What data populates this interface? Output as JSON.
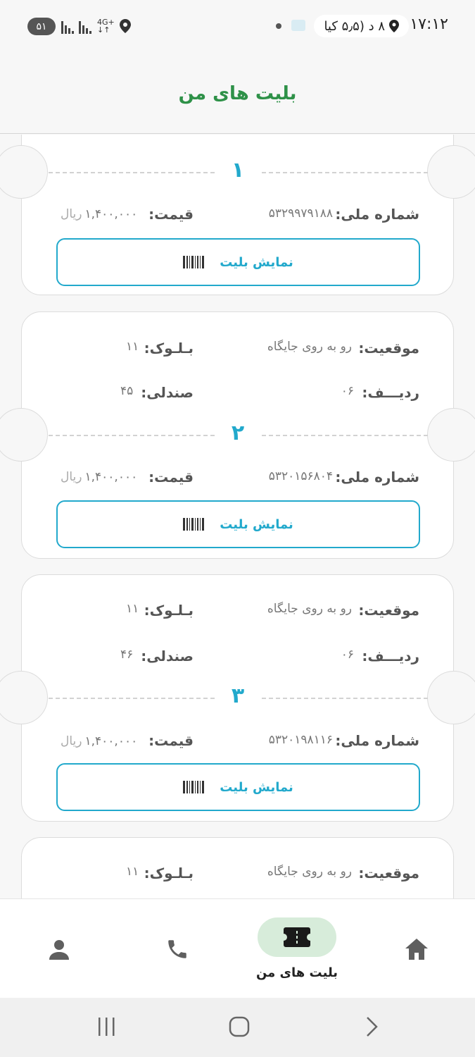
{
  "status_bar": {
    "time": "۱۷:۱۲",
    "navigation_info": "۸ د (۵٫۵ کیا",
    "network_type": "4G+",
    "battery": "۵۱"
  },
  "header": {
    "title": "بلیت های من"
  },
  "labels": {
    "national_id": "شماره ملی:",
    "price": "قیمت:",
    "location": "موقعیت:",
    "block": "بـلـوک:",
    "row": "ردیـــف:",
    "seat": "صندلی:",
    "currency": "ریال",
    "show_ticket": "نمایش بلیت"
  },
  "tickets": [
    {
      "number": "۱",
      "national_id": "۵۳۲۹۹۷۹۱۸۸",
      "price": "۱,۴۰۰,۰۰۰"
    },
    {
      "number": "۲",
      "location": "رو به روی جایگاه",
      "block": "۱۱",
      "row": "۰۶",
      "seat": "۴۵",
      "national_id": "۵۳۲۰۱۵۶۸۰۴",
      "price": "۱,۴۰۰,۰۰۰"
    },
    {
      "number": "۳",
      "location": "رو به روی جایگاه",
      "block": "۱۱",
      "row": "۰۶",
      "seat": "۴۶",
      "national_id": "۵۳۲۰۱۹۸۱۱۶",
      "price": "۱,۴۰۰,۰۰۰"
    },
    {
      "location": "رو به روی جایگاه",
      "block": "۱۱"
    }
  ],
  "bottom_nav": {
    "items": [
      {
        "name": "profile",
        "icon": "person-icon"
      },
      {
        "name": "contact",
        "icon": "phone-icon"
      },
      {
        "name": "my-tickets",
        "icon": "ticket-icon",
        "label": "بلیت های من",
        "active": true
      },
      {
        "name": "home",
        "icon": "home-icon"
      }
    ],
    "active_color": "#d7ecda"
  },
  "colors": {
    "accent": "#22a9cc",
    "title_green": "#2e9148"
  }
}
